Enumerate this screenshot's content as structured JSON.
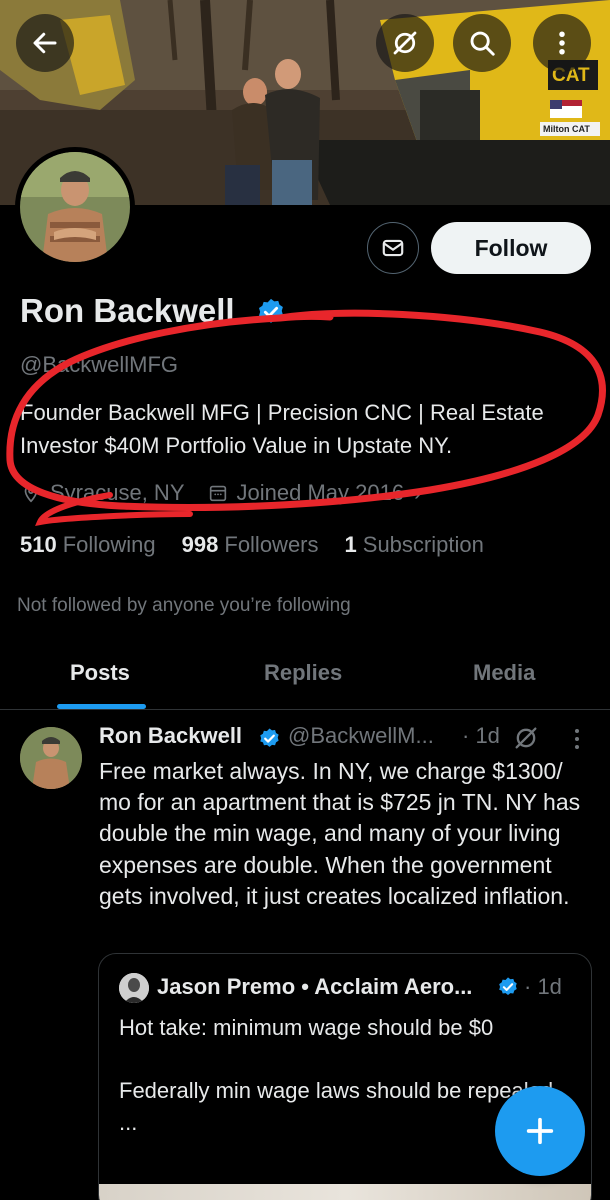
{
  "colors": {
    "background": "#000000",
    "text_primary": "#e7e9ea",
    "text_secondary": "#71767b",
    "accent": "#1d9bf0",
    "annotation": "#e8262b"
  },
  "top_bar": {
    "back_icon": "arrow-left-icon",
    "grok_icon": "grok-icon",
    "search_icon": "search-icon",
    "more_icon": "more-vertical-icon"
  },
  "banner": {
    "cat_badge": "CAT",
    "machine_label": "Milton CAT"
  },
  "profile": {
    "name": "Ron Backwell",
    "handle": "@BackwellMFG",
    "bio": "Founder Backwell MFG | Precision CNC | Real Estate Investor $40M Portfolio Value in Upstate NY.",
    "location": "Syracuse, NY",
    "joined": "Joined May 2016",
    "following_count": "510",
    "following_label": "Following",
    "followers_count": "998",
    "followers_label": "Followers",
    "subscriptions_count": "1",
    "subscriptions_label": "Subscription",
    "not_followed_text": "Not followed by anyone you’re following",
    "follow_label": "Follow",
    "message_icon": "mail-icon"
  },
  "tabs": [
    {
      "label": "Posts",
      "active": true
    },
    {
      "label": "Replies",
      "active": false
    },
    {
      "label": "Media",
      "active": false
    }
  ],
  "post": {
    "author": "Ron Backwell",
    "handle": "@BackwellM...",
    "time": "· 1d",
    "text": "Free market always. In NY, we charge $1300/ mo for an apartment that is $725 jn TN. NY has double the min wage, and many of your living expenses are double. When the government gets involved, it just creates localized inflation.",
    "quote": {
      "author": "Jason Premo • Acclaim Aero...",
      "time": "· 1d",
      "text": "Hot take: minimum wage should be $0\n\nFederally min wage laws should be repealed.\n..."
    }
  },
  "fab": {
    "icon": "plus-icon"
  }
}
